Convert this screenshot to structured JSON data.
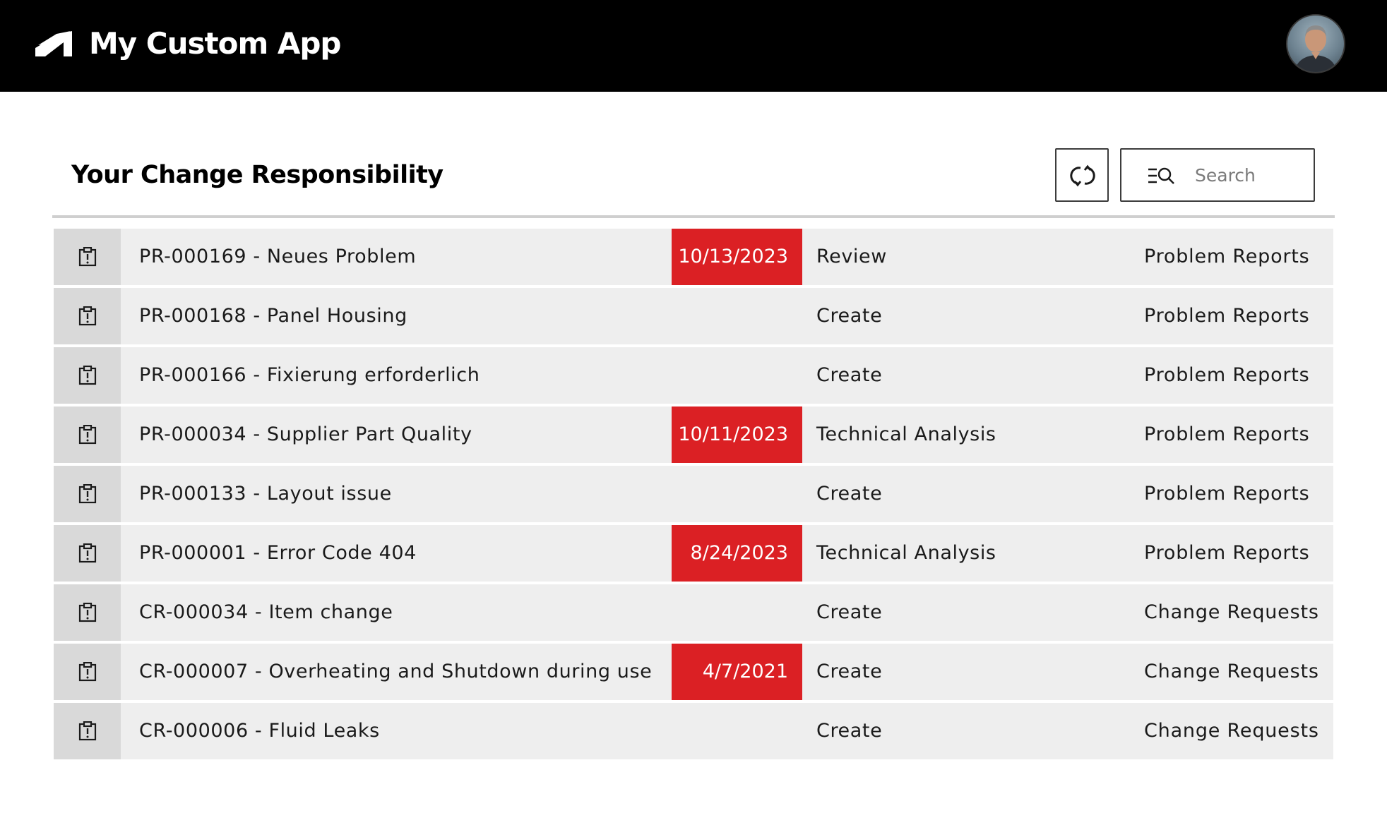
{
  "header": {
    "app_title": "My Custom App",
    "logo_icon": "autodesk-logo-icon",
    "avatar_icon": "user-avatar"
  },
  "section": {
    "title": "Your Change Responsibility",
    "refresh_icon": "refresh-icon",
    "search": {
      "icon": "search-filter-icon",
      "placeholder": "Search",
      "value": ""
    }
  },
  "colors": {
    "header_bg": "#000000",
    "overdue_bg": "#db2024",
    "row_bg": "#eeeeee",
    "icon_cell_bg": "#d9d9d9"
  },
  "rows": [
    {
      "title": "PR-000169 - Neues Problem",
      "due": "10/13/2023",
      "status": "Review",
      "category": "Problem Reports"
    },
    {
      "title": "PR-000168 - Panel Housing",
      "due": "",
      "status": "Create",
      "category": "Problem Reports"
    },
    {
      "title": "PR-000166 - Fixierung erforderlich",
      "due": "",
      "status": "Create",
      "category": "Problem Reports"
    },
    {
      "title": "PR-000034 - Supplier Part Quality",
      "due": "10/11/2023",
      "status": "Technical Analysis",
      "category": "Problem Reports"
    },
    {
      "title": "PR-000133 - Layout issue",
      "due": "",
      "status": "Create",
      "category": "Problem Reports"
    },
    {
      "title": "PR-000001 - Error Code 404",
      "due": "8/24/2023",
      "status": "Technical Analysis",
      "category": "Problem Reports"
    },
    {
      "title": "CR-000034 - Item change",
      "due": "",
      "status": "Create",
      "category": "Change Requests"
    },
    {
      "title": "CR-000007 - Overheating and Shutdown during use",
      "due": "4/7/2021",
      "status": "Create",
      "category": "Change Requests"
    },
    {
      "title": "CR-000006 - Fluid Leaks",
      "due": "",
      "status": "Create",
      "category": "Change Requests"
    }
  ]
}
